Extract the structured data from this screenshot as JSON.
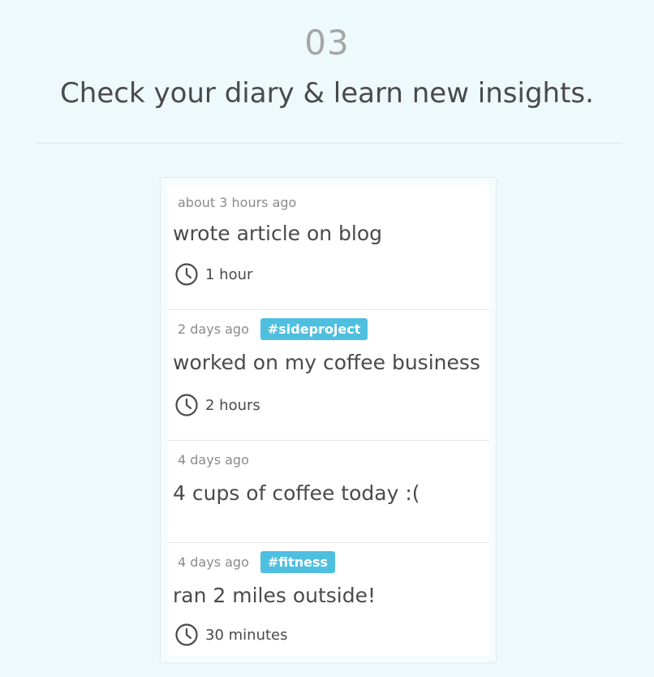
{
  "header": {
    "step_number": "03",
    "title": "Check your diary & learn new insights."
  },
  "colors": {
    "background": "#eef9fb",
    "tag": "#4fbfe0",
    "text": "#4a4a4a",
    "muted": "#8a8a8a"
  },
  "entries": [
    {
      "time": "about 3 hours ago",
      "tag": "",
      "text": "wrote article on blog",
      "duration": "1 hour",
      "duration_icon": "clock-icon"
    },
    {
      "time": "2 days ago",
      "tag": "#sideproject",
      "text": "worked on my coffee business",
      "duration": "2 hours",
      "duration_icon": "clock-icon"
    },
    {
      "time": "4 days ago",
      "tag": "",
      "text": "4 cups of coffee today :(",
      "duration": ""
    },
    {
      "time": "4 days ago",
      "tag": "#fitness",
      "text": "ran 2 miles outside!",
      "duration": "30 minutes",
      "duration_icon": "clock-icon"
    }
  ]
}
